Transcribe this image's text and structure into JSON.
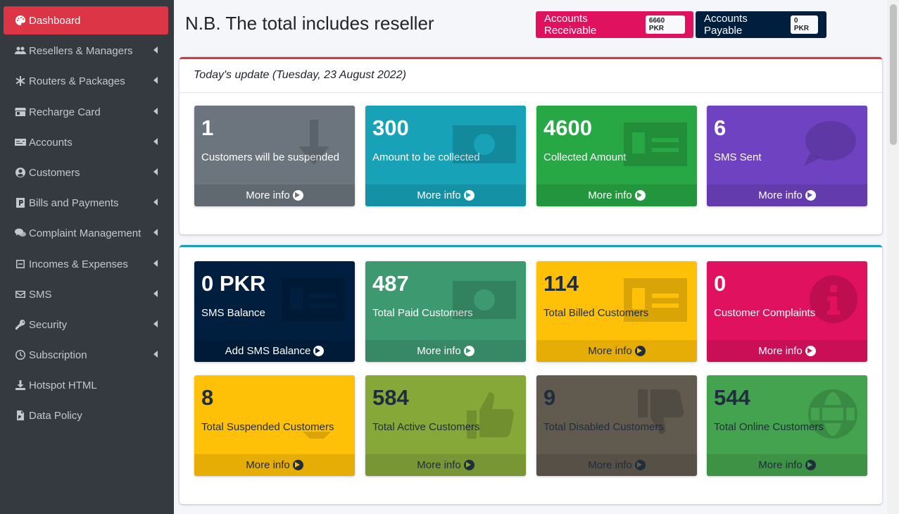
{
  "sidebar": {
    "items": [
      {
        "label": "Dashboard",
        "icon": "palette-icon",
        "active": true,
        "has_caret": false
      },
      {
        "label": "Resellers & Managers",
        "icon": "users-icon",
        "has_caret": true
      },
      {
        "label": "Routers & Packages",
        "icon": "asterisk-icon",
        "has_caret": true
      },
      {
        "label": "Recharge Card",
        "icon": "store-icon",
        "has_caret": true
      },
      {
        "label": "Accounts",
        "icon": "money-check-icon",
        "has_caret": true
      },
      {
        "label": "Customers",
        "icon": "user-circle-icon",
        "has_caret": true
      },
      {
        "label": "Bills and Payments",
        "icon": "parking-icon",
        "has_caret": true
      },
      {
        "label": "Complaint Management",
        "icon": "comments-icon",
        "has_caret": true
      },
      {
        "label": "Incomes & Expenses",
        "icon": "minus-square-icon",
        "has_caret": true
      },
      {
        "label": "SMS",
        "icon": "envelope-icon",
        "has_caret": true
      },
      {
        "label": "Security",
        "icon": "key-icon",
        "has_caret": true
      },
      {
        "label": "Subscription",
        "icon": "clock-icon",
        "has_caret": true
      },
      {
        "label": "Hotspot HTML",
        "icon": "download-icon",
        "has_caret": false
      },
      {
        "label": "Data Policy",
        "icon": "file-pdf-icon",
        "has_caret": false
      }
    ]
  },
  "header": {
    "title": "N.B. The total includes reseller",
    "receivable_label": "Accounts Receivable",
    "receivable_value": "6660 PKR",
    "payable_label": "Accounts Payable",
    "payable_value": "0 PKR"
  },
  "today": {
    "heading": "Today's update (Tuesday, 23 August 2022)",
    "boxes": [
      {
        "value": "1",
        "label": "Customers will be suspended",
        "link": "More info",
        "color": "#6c757d",
        "icon": "arrow-down-icon"
      },
      {
        "value": "300",
        "label": "Amount to be collected",
        "link": "More info",
        "color": "#17a2b8",
        "icon": "money-bill-icon"
      },
      {
        "value": "4600",
        "label": "Collected Amount",
        "link": "More info",
        "color": "#28a745",
        "icon": "money-check-dollar-icon"
      },
      {
        "value": "6",
        "label": "SMS Sent",
        "link": "More info",
        "color": "#6f42c1",
        "icon": "sms-icon"
      }
    ]
  },
  "stats": {
    "boxes": [
      {
        "value": "0 PKR",
        "label": "SMS Balance",
        "link": "Add SMS Balance",
        "color": "#001f3f",
        "icon": "money-check-dollar-icon"
      },
      {
        "value": "487",
        "label": "Total Paid Customers",
        "link": "More info",
        "color": "#3d9970",
        "icon": "money-bill-icon"
      },
      {
        "value": "114",
        "label": "Total Billed Customers",
        "link": "More info",
        "color": "#ffc107",
        "icon": "money-check-dollar-icon"
      },
      {
        "value": "0",
        "label": "Customer Complaints",
        "link": "More info",
        "color": "#e0115f",
        "icon": "info-circle-icon"
      },
      {
        "value": "8",
        "label": "Total Suspended Customers",
        "link": "More info",
        "color": "#ffc107",
        "icon": "caret-down-icon"
      },
      {
        "value": "584",
        "label": "Total Active Customers",
        "link": "More info",
        "color": "#86a839",
        "icon": "thumbs-up-icon"
      },
      {
        "value": "9",
        "label": "Total Disabled Customers",
        "link": "More info",
        "color": "#605a4f",
        "icon": "thumbs-down-icon"
      },
      {
        "value": "544",
        "label": "Total Online Customers",
        "link": "More info",
        "color": "#44a34f",
        "icon": "globe-icon"
      }
    ]
  }
}
